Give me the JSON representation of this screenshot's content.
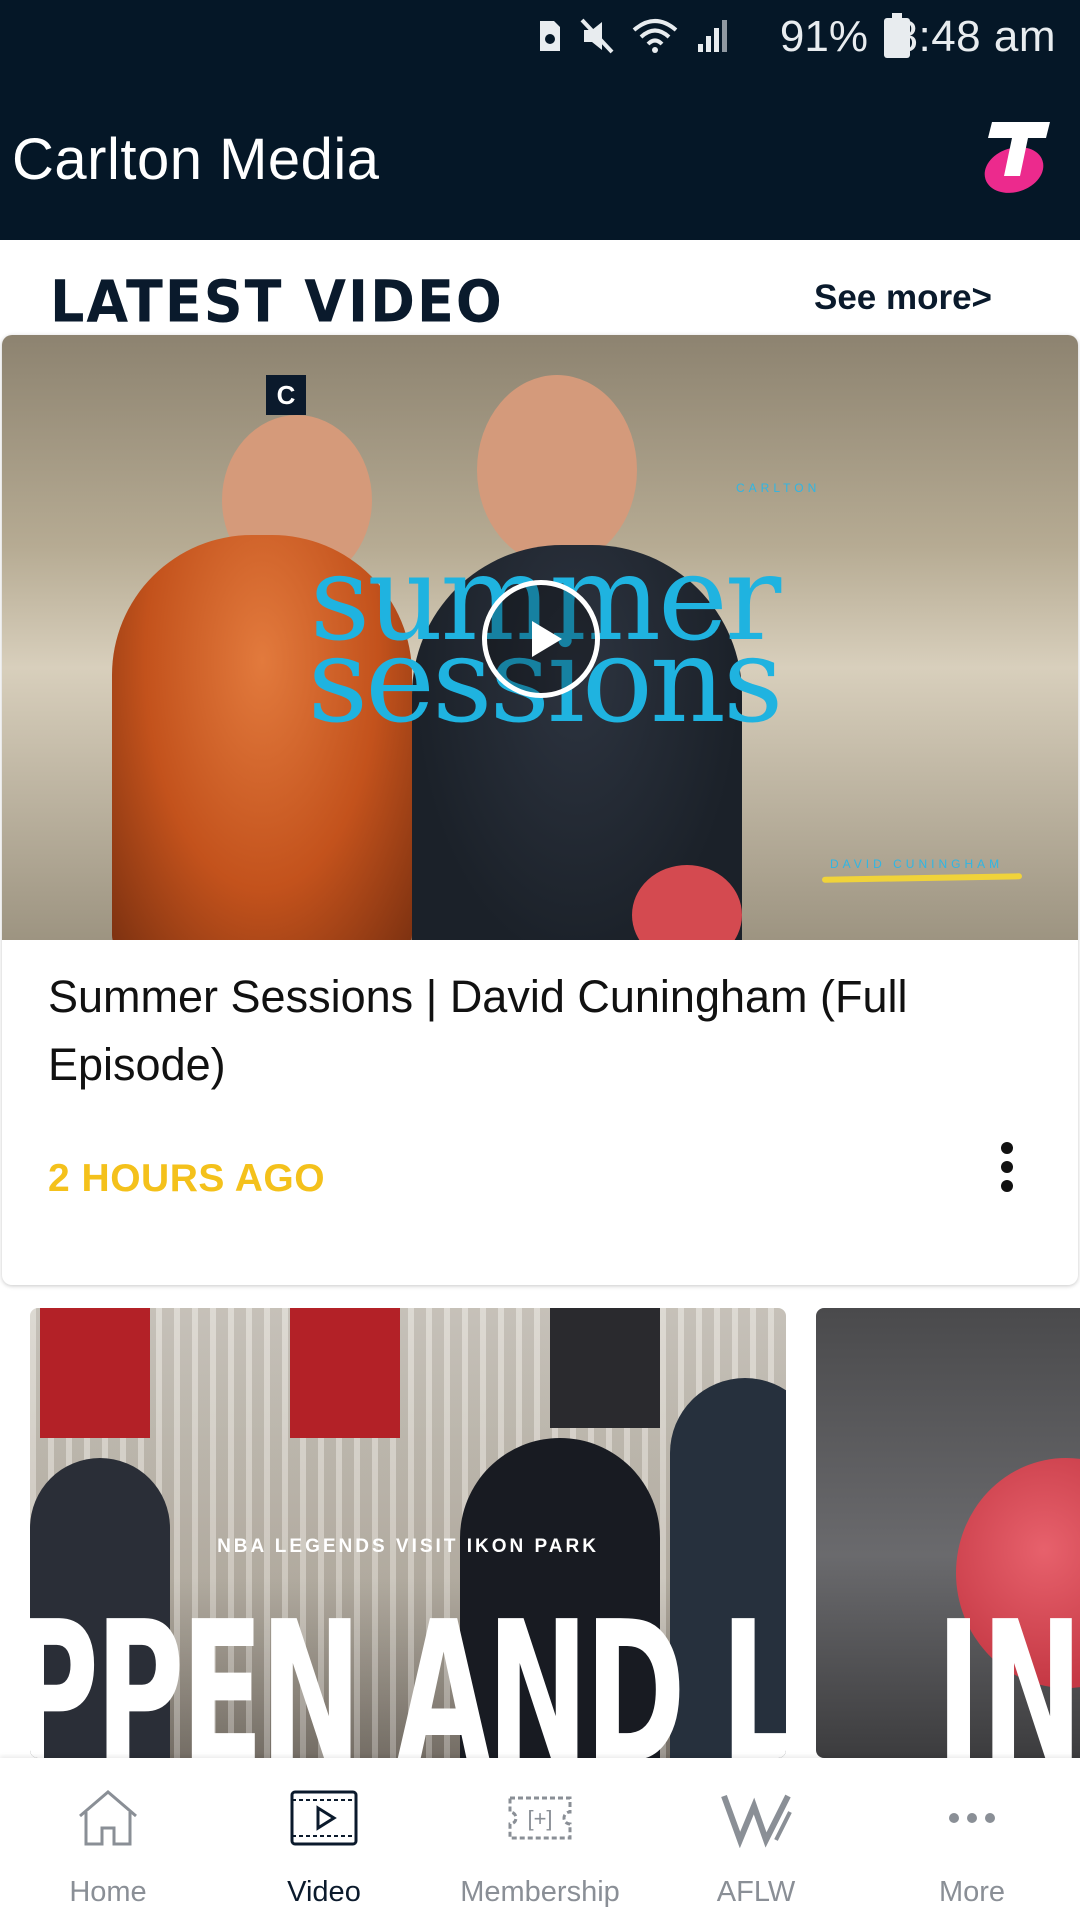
{
  "status_bar": {
    "battery_percent": "91%",
    "time": "8:48 am"
  },
  "header": {
    "title": "Carlton Media",
    "logo_icon": "telstra-logo-icon"
  },
  "section": {
    "title": "LATEST VIDEO",
    "see_more": "See more>"
  },
  "hero": {
    "overlay_title": "summer sessions",
    "club_tag": "CARLTON",
    "name_tag": "DAVID CUNINGHAM",
    "title": "Summer Sessions | David Cuningham (Full Episode)",
    "timestamp": "2 HOURS AGO"
  },
  "carousel": {
    "items": [
      {
        "kicker": "NBA LEGENDS VISIT IKON PARK",
        "headline": "PPEN AND LONGL"
      },
      {
        "headline": "INT"
      }
    ]
  },
  "bottom_nav": {
    "items": [
      {
        "label": "Home",
        "icon": "home-icon"
      },
      {
        "label": "Video",
        "icon": "video-icon",
        "active": true
      },
      {
        "label": "Membership",
        "icon": "membership-icon"
      },
      {
        "label": "AFLW",
        "icon": "aflw-icon"
      },
      {
        "label": "More",
        "icon": "more-icon"
      }
    ]
  },
  "colors": {
    "header_bg": "#051727",
    "accent_yellow": "#f4c11b",
    "brand_pink": "#ec2a8d",
    "text_dark": "#0b1a2c"
  }
}
